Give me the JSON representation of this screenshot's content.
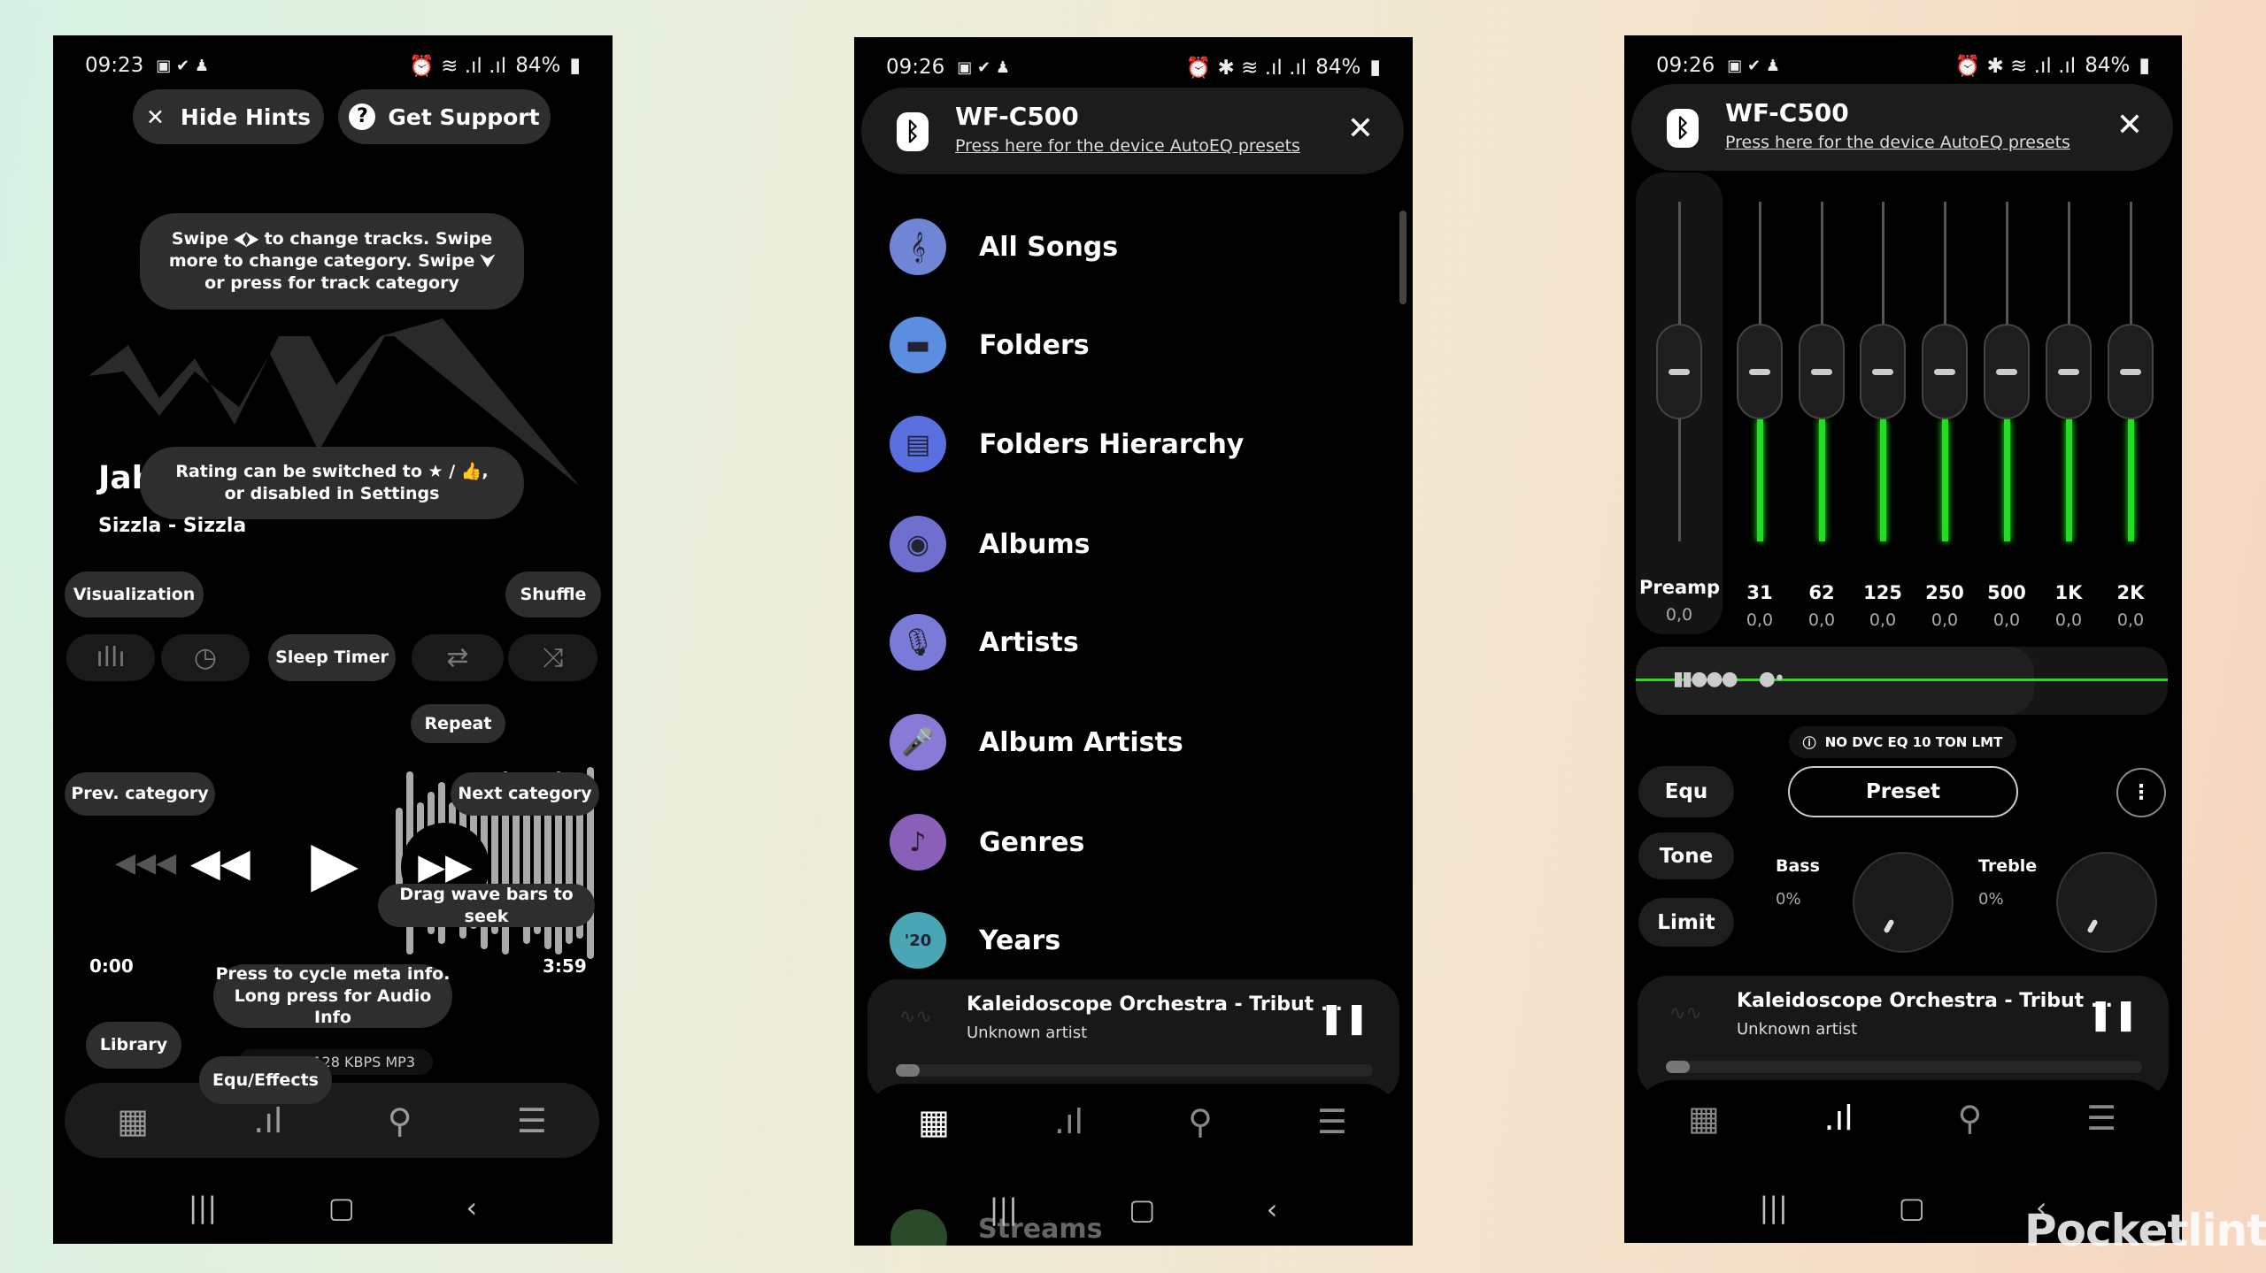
{
  "phones": [
    {
      "status": {
        "time": "09:23",
        "battery": "84%"
      },
      "hide_hints": "Hide Hints",
      "get_support": "Get Support",
      "hint_swipe": "Swipe ⮜⮞ to change tracks. Swipe more to change category. Swipe ⮟ or press for track category",
      "hint_rating": "Rating can be switched to ★ / 👍, or disabled in Settings",
      "track_title": "Jah",
      "track_artist": "Sizzla - Sizzla",
      "hints": {
        "visualization": "Visualization",
        "shuffle": "Shuffle",
        "sleep_timer": "Sleep Timer",
        "repeat": "Repeat",
        "prev_category": "Prev. category",
        "next_category": "Next category",
        "drag_wave": "Drag wave bars to seek",
        "meta_info": "Press to cycle meta info. Long press for Audio Info",
        "library": "Library",
        "equ_effects": "Equ/Effects"
      },
      "time_elapsed": "0:00",
      "time_total": "3:59",
      "audio_info": "128 KBPS  MP3"
    },
    {
      "status": {
        "time": "09:26",
        "battery": "84%"
      },
      "device": {
        "name": "WF-C500",
        "link": "Press here for the device AutoEQ presets"
      },
      "library": [
        {
          "label": "All Songs",
          "icon": "treble-clef-icon",
          "color": "#6f86d6"
        },
        {
          "label": "Folders",
          "icon": "folder-icon",
          "color": "#5b8de0"
        },
        {
          "label": "Folders Hierarchy",
          "icon": "folder-tree-icon",
          "color": "#5a6fe0"
        },
        {
          "label": "Albums",
          "icon": "disc-icon",
          "color": "#6f6fd0"
        },
        {
          "label": "Artists",
          "icon": "microphone-icon",
          "color": "#7a7ad8"
        },
        {
          "label": "Album Artists",
          "icon": "microphone-person-icon",
          "color": "#8a7ad8"
        },
        {
          "label": "Genres",
          "icon": "guitar-icon",
          "color": "#8a5fb8"
        },
        {
          "label": "Years",
          "icon": "calendar-years-icon",
          "color": "#4aa5b5"
        }
      ],
      "years_icon_text": "'20",
      "behind_item": "Streams",
      "mini": {
        "title": "Kaleidoscope Orchestra - Tribut ...",
        "artist": "Unknown artist",
        "progress": 0.05
      }
    },
    {
      "status": {
        "time": "09:26",
        "battery": "84%"
      },
      "device": {
        "name": "WF-C500",
        "link": "Press here for the device AutoEQ presets"
      },
      "eq": {
        "bands": [
          {
            "label": "Preamp",
            "value": "0,0"
          },
          {
            "label": "31",
            "value": "0,0"
          },
          {
            "label": "62",
            "value": "0,0"
          },
          {
            "label": "125",
            "value": "0,0"
          },
          {
            "label": "250",
            "value": "0,0"
          },
          {
            "label": "500",
            "value": "0,0"
          },
          {
            "label": "1K",
            "value": "0,0"
          },
          {
            "label": "2K",
            "value": "0,0"
          }
        ],
        "notice": "NO DVC EQ 10 TON LMT",
        "equ": "Equ",
        "preset": "Preset",
        "tone": "Tone",
        "limit": "Limit",
        "bass_label": "Bass",
        "bass_value": "0%",
        "treble_label": "Treble",
        "treble_value": "0%",
        "accent": "#22dd22"
      },
      "mini": {
        "title": "Kaleidoscope Orchestra - Tribut ...",
        "artist": "Unknown artist",
        "progress": 0.05
      }
    }
  ],
  "watermark": "Pocketlint"
}
